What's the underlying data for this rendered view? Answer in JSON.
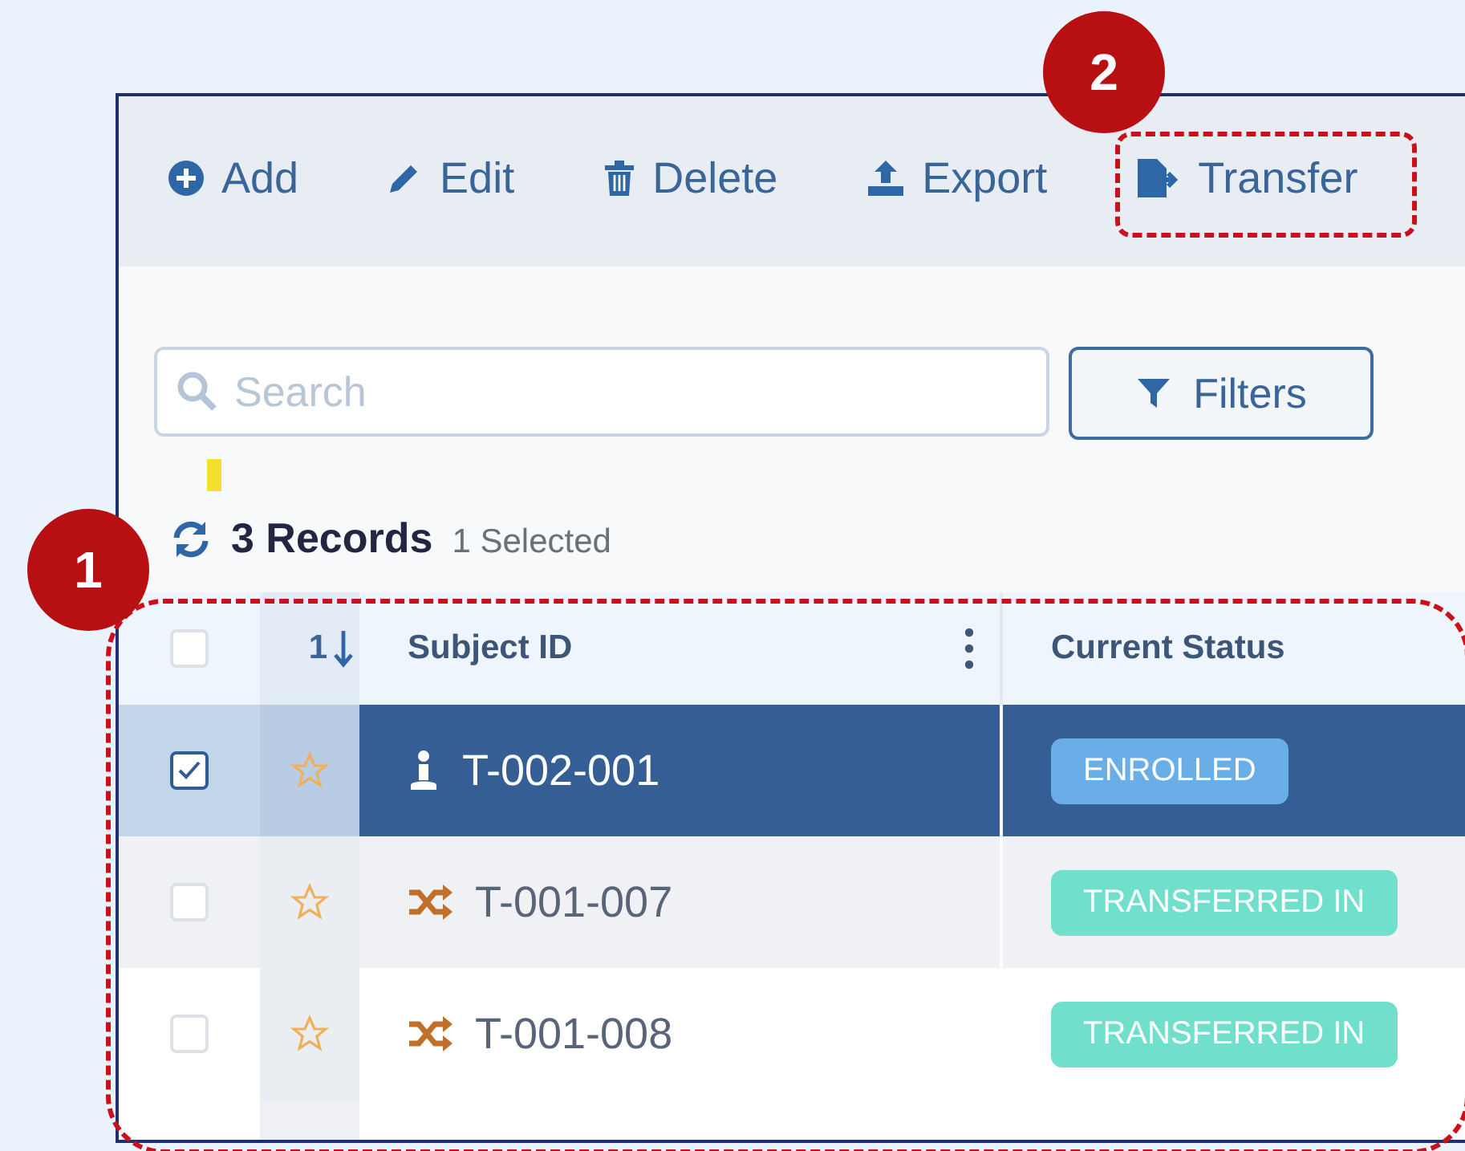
{
  "toolbar": [
    {
      "kind": "add",
      "label": "Add"
    },
    {
      "kind": "edit",
      "label": "Edit"
    },
    {
      "kind": "delete",
      "label": "Delete"
    },
    {
      "kind": "export",
      "label": "Export"
    },
    {
      "kind": "transfer",
      "label": "Transfer"
    }
  ],
  "search": {
    "placeholder": "Search"
  },
  "filters_button": "Filters",
  "summary": {
    "records": "3 Records",
    "selected": "1 Selected"
  },
  "table": {
    "sort_index": "1",
    "columns": [
      "Subject ID",
      "Current Status"
    ],
    "header_checked": false,
    "rows": [
      {
        "selected": true,
        "checked": true,
        "starred": false,
        "kind": "enrolled",
        "subject_id": "T-002-001",
        "status": "ENROLLED",
        "color": "#6aaee8"
      },
      {
        "selected": false,
        "checked": false,
        "starred": false,
        "kind": "transferred",
        "subject_id": "T-001-007",
        "status": "TRANSFERRED IN",
        "color": "#70e0cd"
      },
      {
        "selected": false,
        "checked": false,
        "starred": false,
        "kind": "transferred",
        "subject_id": "T-001-008",
        "status": "TRANSFERRED IN",
        "color": "#70e0cd"
      }
    ]
  },
  "callouts": [
    {
      "label": "1"
    },
    {
      "label": "2"
    }
  ]
}
